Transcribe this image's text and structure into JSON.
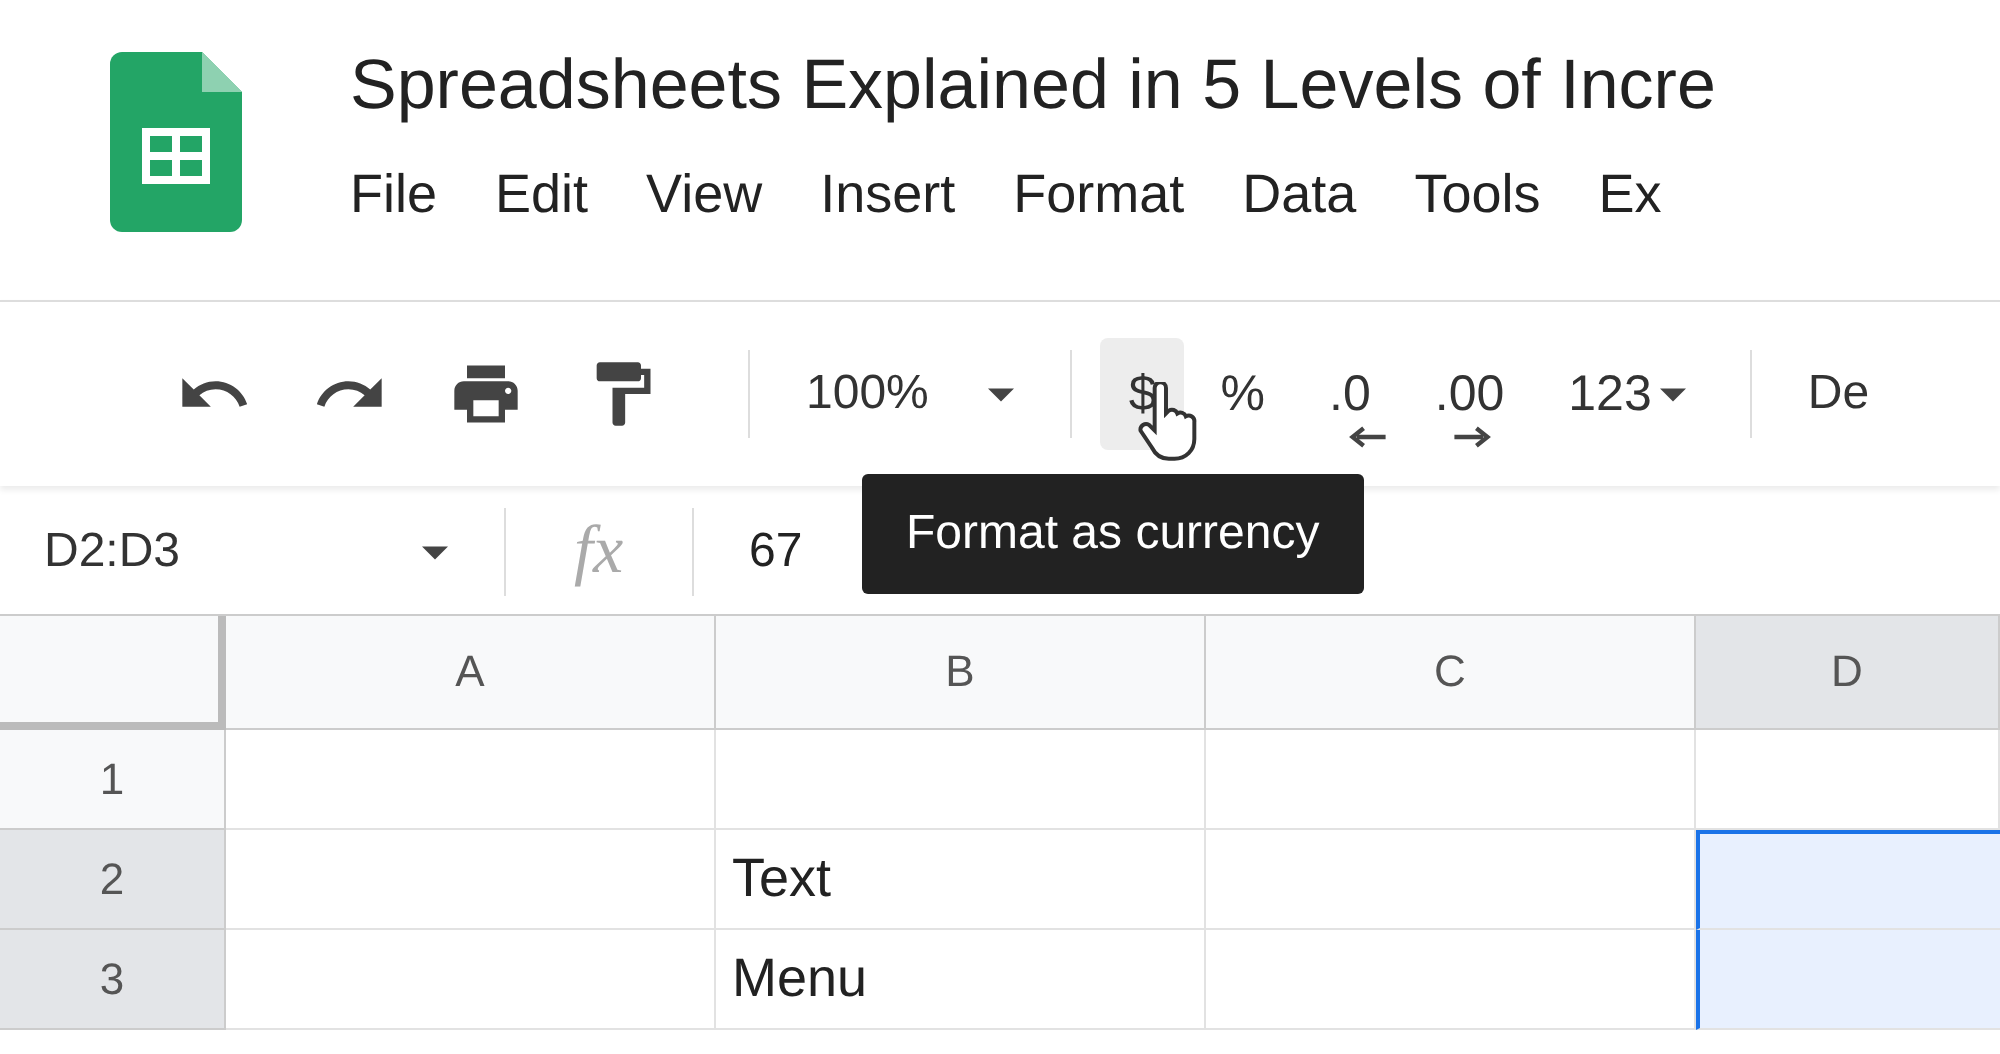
{
  "document": {
    "title": "Spreadsheets Explained in 5 Levels of Incre"
  },
  "menu": [
    "File",
    "Edit",
    "View",
    "Insert",
    "Format",
    "Data",
    "Tools",
    "Ex"
  ],
  "toolbar": {
    "zoom": "100%",
    "format_buttons": [
      {
        "label": "$",
        "selected": true
      },
      {
        "label": "%",
        "selected": false
      },
      {
        "label": ".0",
        "selected": false,
        "kind": "decrease"
      },
      {
        "label": ".00",
        "selected": false,
        "kind": "increase"
      },
      {
        "label": "123",
        "selected": false,
        "kind": "menu"
      }
    ],
    "font": "De"
  },
  "tooltip": "Format as currency",
  "formula_bar": {
    "name_box": "D2:D3",
    "fx": "fx",
    "value": "67"
  },
  "columns": [
    {
      "label": "A",
      "selected": false
    },
    {
      "label": "B",
      "selected": false
    },
    {
      "label": "C",
      "selected": false
    },
    {
      "label": "D",
      "selected": true
    }
  ],
  "rows": [
    {
      "number": "1",
      "selected": false,
      "cells": [
        {
          "text": "",
          "selected": false
        },
        {
          "text": "",
          "selected": false
        },
        {
          "text": "",
          "selected": false
        },
        {
          "text": "",
          "selected": false
        }
      ]
    },
    {
      "number": "2",
      "selected": true,
      "cells": [
        {
          "text": "",
          "selected": false
        },
        {
          "text": "Text",
          "selected": false
        },
        {
          "text": "",
          "selected": false
        },
        {
          "text": "",
          "selected": true
        }
      ]
    },
    {
      "number": "3",
      "selected": true,
      "cells": [
        {
          "text": "",
          "selected": false
        },
        {
          "text": "Menu",
          "selected": false
        },
        {
          "text": "",
          "selected": false
        },
        {
          "text": "",
          "selected": true
        }
      ]
    }
  ]
}
